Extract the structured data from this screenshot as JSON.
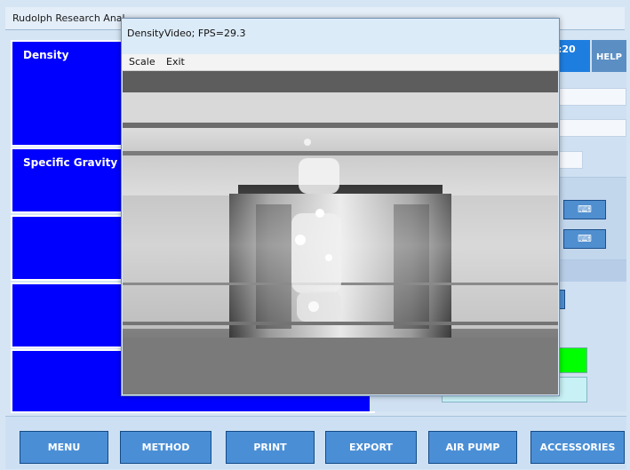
{
  "app": {
    "title": "Rudolph Research Anal"
  },
  "left_panels": [
    {
      "label": "Density"
    },
    {
      "label": "Specific Gravity"
    },
    {
      "label": ""
    },
    {
      "label": ""
    },
    {
      "label": ""
    }
  ],
  "right_panel": {
    "time_fragment": ":20",
    "help_label": "HELP"
  },
  "video_window": {
    "title": "DensityVideo;  FPS=29.3",
    "menu": {
      "scale": "Scale",
      "exit": "Exit"
    }
  },
  "bottom_nav": [
    {
      "label": "MENU"
    },
    {
      "label": "METHOD"
    },
    {
      "label": "PRINT"
    },
    {
      "label": "EXPORT"
    },
    {
      "label": "AIR PUMP"
    },
    {
      "label": "ACCESSORIES"
    }
  ],
  "colors": {
    "panel_blue": "#0000ff",
    "button_blue": "#4a8fd6",
    "green_status": "#00ff00",
    "cyan_status": "#c8f1f6"
  },
  "icons": {
    "keyboard": "keyboard-icon"
  }
}
